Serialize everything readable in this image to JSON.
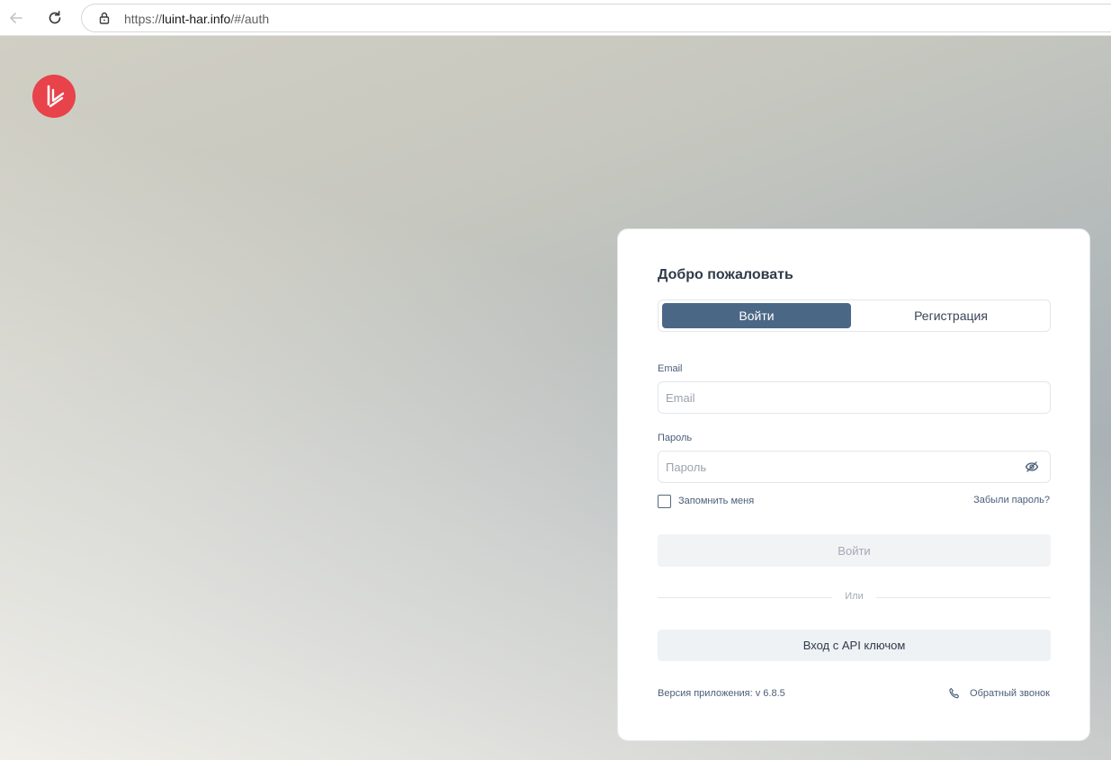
{
  "browser": {
    "url_scheme": "https://",
    "url_host": "luint-har.info",
    "url_path": "/#/auth"
  },
  "brand": {
    "logo_icon": "brand-logo",
    "accent_color": "#e8424a"
  },
  "auth": {
    "title": "Добро пожаловать",
    "tabs": [
      {
        "label": "Войти",
        "active": true
      },
      {
        "label": "Регистрация",
        "active": false
      }
    ],
    "email": {
      "label": "Email",
      "placeholder": "Email",
      "value": ""
    },
    "password": {
      "label": "Пароль",
      "placeholder": "Пароль",
      "value": "",
      "toggle_icon": "eye-off-icon"
    },
    "remember_label": "Запомнить меня",
    "remember_checked": false,
    "forgot_label": "Забыли пароль?",
    "submit_label": "Войти",
    "divider_label": "Или",
    "api_login_label": "Вход с API ключом",
    "version_label": "Версия приложения: v 6.8.5",
    "callback_label": "Обратный звонок",
    "callback_icon": "phone-icon",
    "primary_color": "#4a6786"
  }
}
